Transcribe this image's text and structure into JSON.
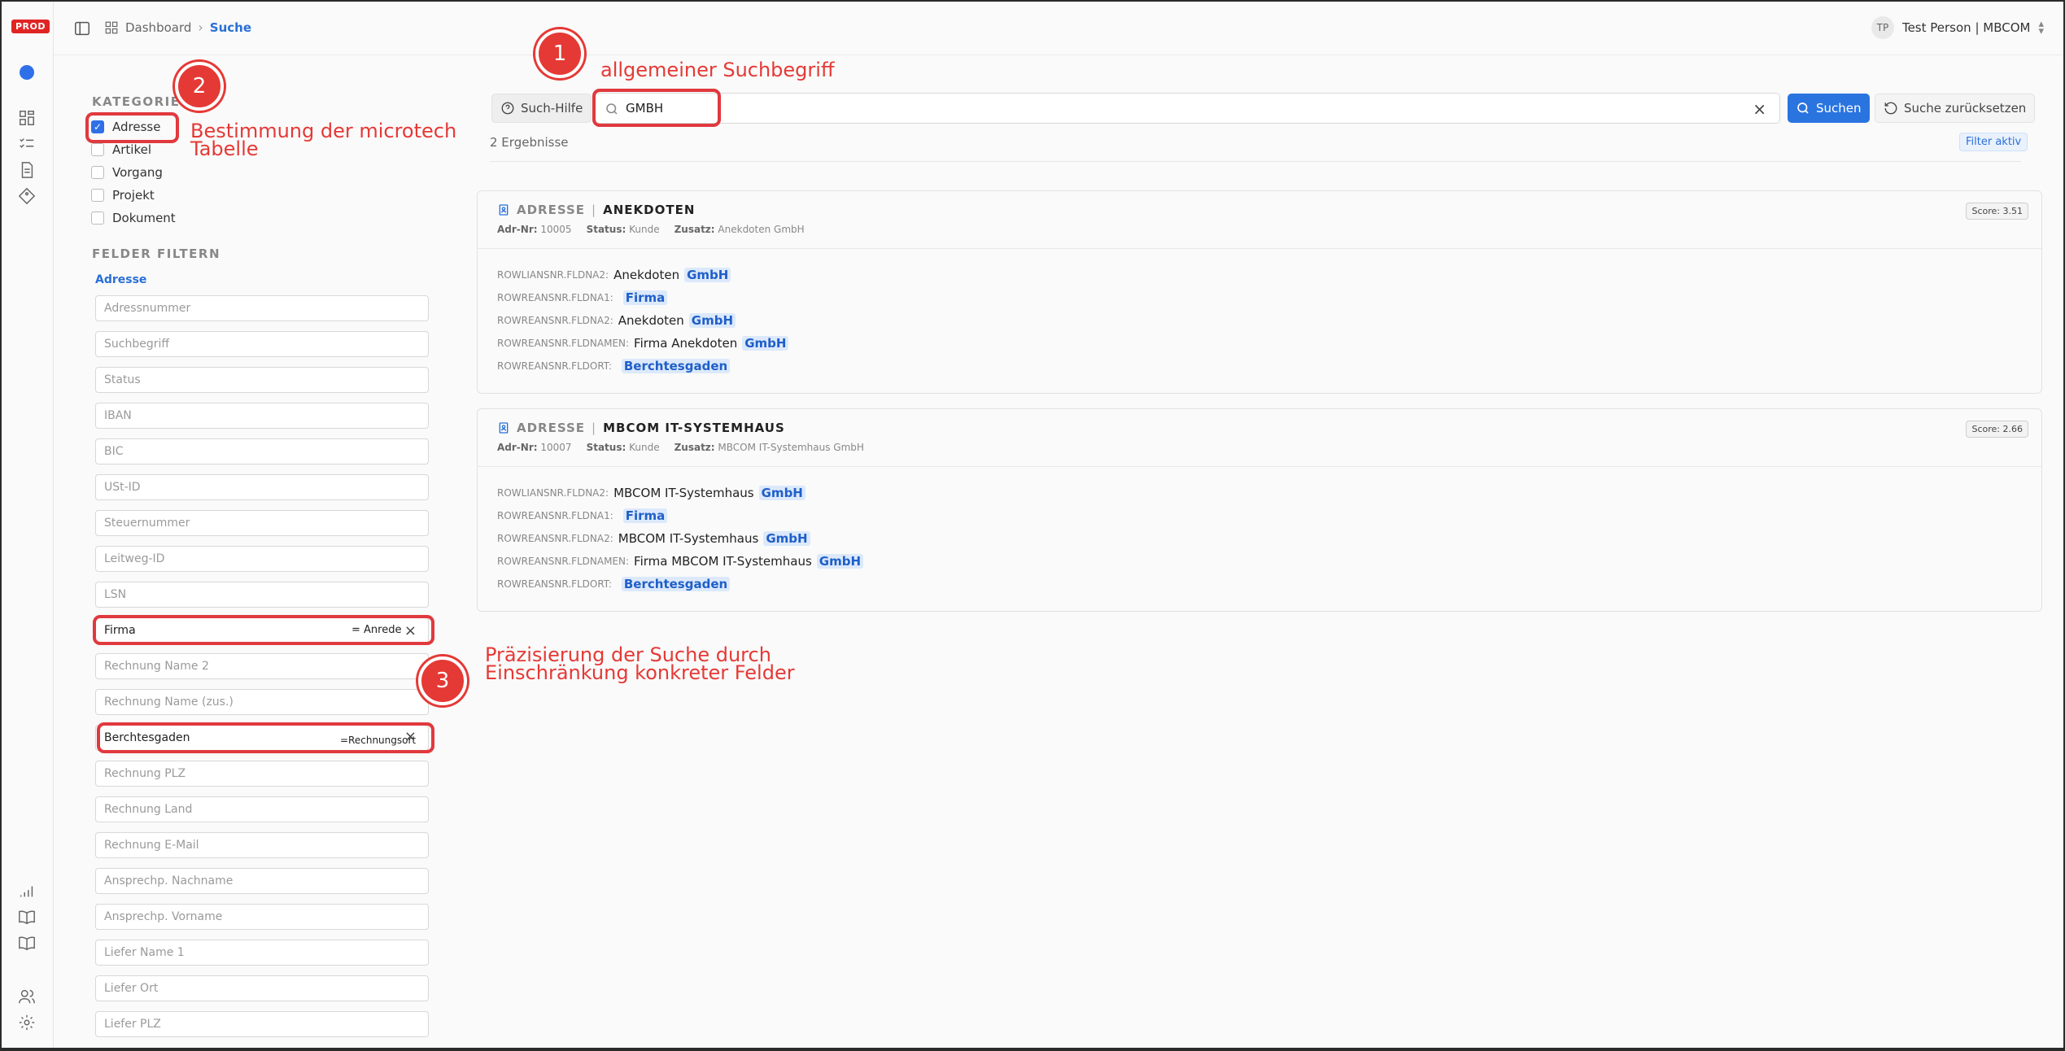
{
  "env_badge": "PROD",
  "breadcrumb": {
    "home": "Dashboard",
    "current": "Suche"
  },
  "user": {
    "initials": "TP",
    "name": "Test Person | MBCOM"
  },
  "sidebar": {
    "categories_title": "KATEGORIEN",
    "categories": [
      {
        "label": "Adresse",
        "checked": true
      },
      {
        "label": "Artikel",
        "checked": false
      },
      {
        "label": "Vorgang",
        "checked": false
      },
      {
        "label": "Projekt",
        "checked": false
      },
      {
        "label": "Dokument",
        "checked": false
      }
    ],
    "filter_title": "FELDER FILTERN",
    "filter_subtitle": "Adresse",
    "fields": [
      {
        "placeholder": "Adressnummer",
        "value": ""
      },
      {
        "placeholder": "Suchbegriff",
        "value": ""
      },
      {
        "placeholder": "Status",
        "value": ""
      },
      {
        "placeholder": "IBAN",
        "value": ""
      },
      {
        "placeholder": "BIC",
        "value": ""
      },
      {
        "placeholder": "USt-ID",
        "value": ""
      },
      {
        "placeholder": "Steuernummer",
        "value": ""
      },
      {
        "placeholder": "Leitweg-ID",
        "value": ""
      },
      {
        "placeholder": "LSN",
        "value": ""
      },
      {
        "placeholder": "",
        "value": "Firma",
        "operator": "= Anrede"
      },
      {
        "placeholder": "Rechnung Name 2",
        "value": ""
      },
      {
        "placeholder": "Rechnung Name (zus.)",
        "value": ""
      },
      {
        "placeholder": "",
        "value": "Berchtesgaden",
        "operator": "=Rechnungsort"
      },
      {
        "placeholder": "Rechnung PLZ",
        "value": ""
      },
      {
        "placeholder": "Rechnung Land",
        "value": ""
      },
      {
        "placeholder": "Rechnung E-Mail",
        "value": ""
      },
      {
        "placeholder": "Ansprechp. Nachname",
        "value": ""
      },
      {
        "placeholder": "Ansprechp. Vorname",
        "value": ""
      },
      {
        "placeholder": "Liefer Name 1",
        "value": ""
      },
      {
        "placeholder": "Liefer Ort",
        "value": ""
      },
      {
        "placeholder": "Liefer PLZ",
        "value": ""
      }
    ]
  },
  "search": {
    "help_label": "Such-Hilfe",
    "query": "GMBH",
    "submit_label": "Suchen",
    "reset_label": "Suche zurücksetzen",
    "result_count": "2 Ergebnisse",
    "filter_badge": "Filter aktiv"
  },
  "results": [
    {
      "type": "ADRESSE",
      "name": "ANEKDOTEN",
      "score": "Score: 3.51",
      "meta": {
        "nr_label": "Adr-Nr:",
        "nr": "10005",
        "status_label": "Status:",
        "status": "Kunde",
        "zusatz_label": "Zusatz:",
        "zusatz": "Anekdoten GmbH"
      },
      "rows": [
        {
          "field": "ROWLIANSNR.FLDNA2:",
          "text": "Anekdoten",
          "hl": "GmbH"
        },
        {
          "field": "ROWREANSNR.FLDNA1:",
          "text": "",
          "hl": "Firma"
        },
        {
          "field": "ROWREANSNR.FLDNA2:",
          "text": "Anekdoten",
          "hl": "GmbH"
        },
        {
          "field": "ROWREANSNR.FLDNAMEN:",
          "text": "Firma Anekdoten",
          "hl": "GmbH"
        },
        {
          "field": "ROWREANSNR.FLDORT:",
          "text": "",
          "hl": "Berchtesgaden"
        }
      ]
    },
    {
      "type": "ADRESSE",
      "name": "MBCOM IT-SYSTEMHAUS",
      "score": "Score: 2.66",
      "meta": {
        "nr_label": "Adr-Nr:",
        "nr": "10007",
        "status_label": "Status:",
        "status": "Kunde",
        "zusatz_label": "Zusatz:",
        "zusatz": "MBCOM IT-Systemhaus GmbH"
      },
      "rows": [
        {
          "field": "ROWLIANSNR.FLDNA2:",
          "text": "MBCOM IT-Systemhaus",
          "hl": "GmbH"
        },
        {
          "field": "ROWREANSNR.FLDNA1:",
          "text": "",
          "hl": "Firma"
        },
        {
          "field": "ROWREANSNR.FLDNA2:",
          "text": "MBCOM IT-Systemhaus",
          "hl": "GmbH"
        },
        {
          "field": "ROWREANSNR.FLDNAMEN:",
          "text": "Firma MBCOM IT-Systemhaus",
          "hl": "GmbH"
        },
        {
          "field": "ROWREANSNR.FLDORT:",
          "text": "",
          "hl": "Berchtesgaden"
        }
      ]
    }
  ],
  "annotations": {
    "one": {
      "num": "1",
      "text": "allgemeiner Suchbegriff"
    },
    "two": {
      "num": "2",
      "line1": "Bestimmung der microtech",
      "line2": "Tabelle"
    },
    "three": {
      "num": "3",
      "line1": "Präzisierung der Suche durch",
      "line2": "Einschränkung konkreter Felder"
    }
  },
  "colors": {
    "accent": "#2a74e0",
    "annotation": "#e53935",
    "highlight_bg": "#dce9fb"
  }
}
